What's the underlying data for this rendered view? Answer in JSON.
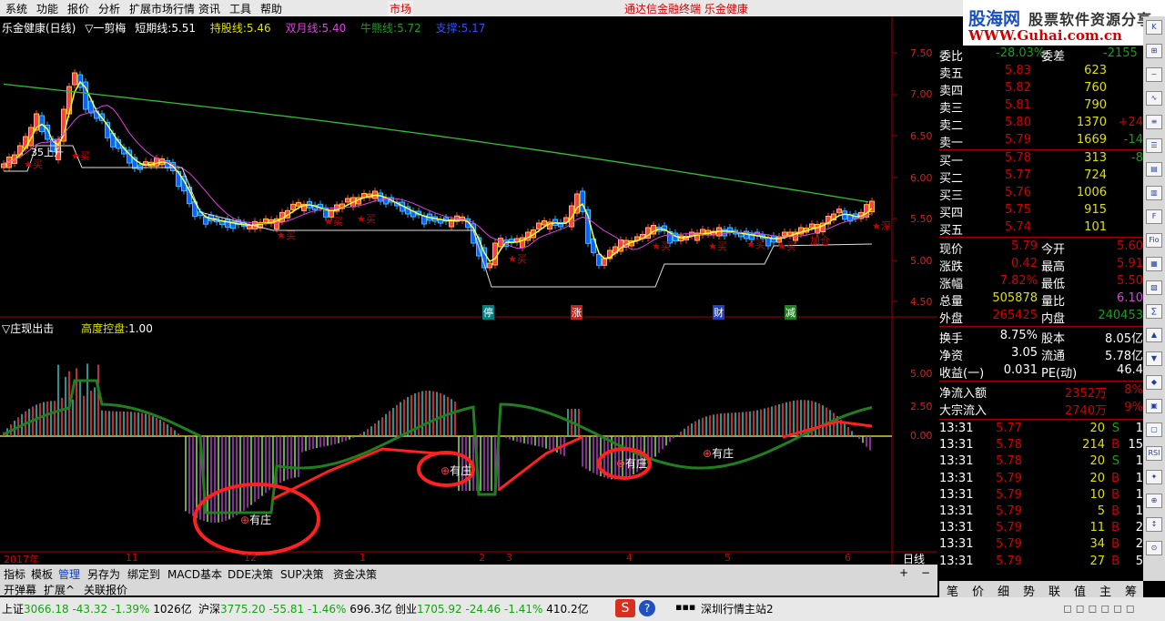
{
  "menu": {
    "items": [
      "系统",
      "功能",
      "报价",
      "分析",
      "扩展市场行情",
      "资讯",
      "工具",
      "帮助"
    ],
    "market_label": "市场",
    "center_title": "通达信金融终端  乐金健康"
  },
  "logo": {
    "site_cn": "股海网",
    "tagline": "股票软件资源分享",
    "url": "WWW.Guhai.com.cn"
  },
  "chart_header": {
    "name": "乐金健康(日线)",
    "formula": "▽一剪梅",
    "short_label": "短期线:",
    "short_val": "5.51",
    "hold_label": "持股线:",
    "hold_val": "5.46",
    "double_label": "双月线:",
    "double_val": "5.40",
    "bull_label": "牛熊线:",
    "bull_val": "5.72",
    "support_label": "支撑:",
    "support_val": "5.17"
  },
  "price_axis": [
    "7.50",
    "7.00",
    "6.50",
    "6.00",
    "5.50",
    "5.00",
    "4.50"
  ],
  "ind_axis": [
    "5.00",
    "2.50",
    "0.00"
  ],
  "indicator_header": {
    "name": "▽庄现出击",
    "label": "高度控盘:",
    "value": "1.00"
  },
  "annotations": {
    "buy": "买",
    "up35": "35上升",
    "stop": "停",
    "zhang": "涨",
    "cai": "财",
    "jian": "减",
    "jiacang": "加仓",
    "youzhuang": "有庄",
    "deep": "深"
  },
  "date_axis": [
    "2017年",
    "11",
    "12",
    "1",
    "2",
    "3",
    "4",
    "5",
    "6"
  ],
  "period_label": "日线",
  "side": {
    "top": {
      "label": "委比",
      "val": "-28.03%",
      "label2": "委差",
      "val2": "-2155"
    },
    "sell": [
      {
        "label": "卖五",
        "price": "5.83",
        "vol": "623",
        "chg": ""
      },
      {
        "label": "卖四",
        "price": "5.82",
        "vol": "760",
        "chg": ""
      },
      {
        "label": "卖三",
        "price": "5.81",
        "vol": "790",
        "chg": ""
      },
      {
        "label": "卖二",
        "price": "5.80",
        "vol": "1370",
        "chg": "+24"
      },
      {
        "label": "卖一",
        "price": "5.79",
        "vol": "1669",
        "chg": "-14"
      }
    ],
    "buy": [
      {
        "label": "买一",
        "price": "5.78",
        "vol": "313",
        "chg": "-8"
      },
      {
        "label": "买二",
        "price": "5.77",
        "vol": "724",
        "chg": ""
      },
      {
        "label": "买三",
        "price": "5.76",
        "vol": "1006",
        "chg": ""
      },
      {
        "label": "买四",
        "price": "5.75",
        "vol": "915",
        "chg": ""
      },
      {
        "label": "买五",
        "price": "5.74",
        "vol": "101",
        "chg": ""
      }
    ],
    "stats": [
      {
        "l1": "现价",
        "v1": "5.79",
        "l2": "今开",
        "v2": "5.60"
      },
      {
        "l1": "涨跌",
        "v1": "0.42",
        "l2": "最高",
        "v2": "5.91"
      },
      {
        "l1": "涨幅",
        "v1": "7.82%",
        "l2": "最低",
        "v2": "5.50"
      },
      {
        "l1": "总量",
        "v1": "505878",
        "l2": "量比",
        "v2": "6.10"
      },
      {
        "l1": "外盘",
        "v1": "265425",
        "l2": "内盘",
        "v2": "240453"
      }
    ],
    "fund": [
      {
        "l1": "换手",
        "v1": "8.75%",
        "l2": "股本",
        "v2": "8.05亿"
      },
      {
        "l1": "净资",
        "v1": "3.05",
        "l2": "流通",
        "v2": "5.78亿"
      },
      {
        "l1": "收益(一)",
        "v1": "0.031",
        "l2": "PE(动)",
        "v2": "46.4"
      }
    ],
    "flow": [
      {
        "label": "净流入额",
        "val": "2352万",
        "pct": "8%"
      },
      {
        "label": "大宗流入",
        "val": "2740万",
        "pct": "9%"
      }
    ],
    "ticks": [
      {
        "t": "13:31",
        "p": "5.77",
        "v": "20",
        "d": "S",
        "n": "1"
      },
      {
        "t": "13:31",
        "p": "5.78",
        "v": "214",
        "d": "B",
        "n": "15"
      },
      {
        "t": "13:31",
        "p": "5.78",
        "v": "20",
        "d": "S",
        "n": "1"
      },
      {
        "t": "13:31",
        "p": "5.79",
        "v": "20",
        "d": "B",
        "n": "1"
      },
      {
        "t": "13:31",
        "p": "5.79",
        "v": "10",
        "d": "B",
        "n": "1"
      },
      {
        "t": "13:31",
        "p": "5.79",
        "v": "5",
        "d": "B",
        "n": "1"
      },
      {
        "t": "13:31",
        "p": "5.79",
        "v": "11",
        "d": "B",
        "n": "2"
      },
      {
        "t": "13:31",
        "p": "5.79",
        "v": "34",
        "d": "B",
        "n": "2"
      },
      {
        "t": "13:31",
        "p": "5.79",
        "v": "27",
        "d": "B",
        "n": "5"
      }
    ]
  },
  "side_tabs": [
    "笔",
    "价",
    "细",
    "势",
    "联",
    "值",
    "主",
    "筹"
  ],
  "icons": [
    "K",
    "⊞",
    "~",
    "∿",
    "≡",
    "☰",
    "▤",
    "▥",
    "F",
    "Fio",
    "▦",
    "▧",
    "∑",
    "▲",
    "▼",
    "◆",
    "▣",
    "▢",
    "RSI",
    "✦",
    "⊕",
    "↕",
    "⊙"
  ],
  "tabs": [
    "指标",
    "模板",
    "管理",
    "另存为",
    "绑定到",
    "MACD基本",
    "DDE决策",
    "SUP决策",
    "资金决策"
  ],
  "tabs2": [
    "开弹幕",
    "扩展^",
    "关联报价"
  ],
  "status": {
    "sh_label": "上证",
    "sh_val": "3066.18",
    "sh_chg": "-43.32",
    "sh_pct": "-1.39%",
    "sh_amt": "1026亿",
    "hs_label": "沪深",
    "hs_val": "3775.20",
    "hs_chg": "-55.81",
    "hs_pct": "-1.46%",
    "hs_amt": "696.3亿",
    "cy_label": "创业",
    "cy_val": "1705.92",
    "cy_chg": "-24.46",
    "cy_pct": "-1.41%",
    "cy_amt": "410.2亿",
    "server": "深圳行情主站2"
  },
  "colors": {
    "up": "#ff3030",
    "down": "#00c0ff",
    "ma_short": "#ffffff",
    "ma_hold": "#ffff40",
    "ma_double": "#e040e0",
    "ma_bull": "#30c030"
  }
}
